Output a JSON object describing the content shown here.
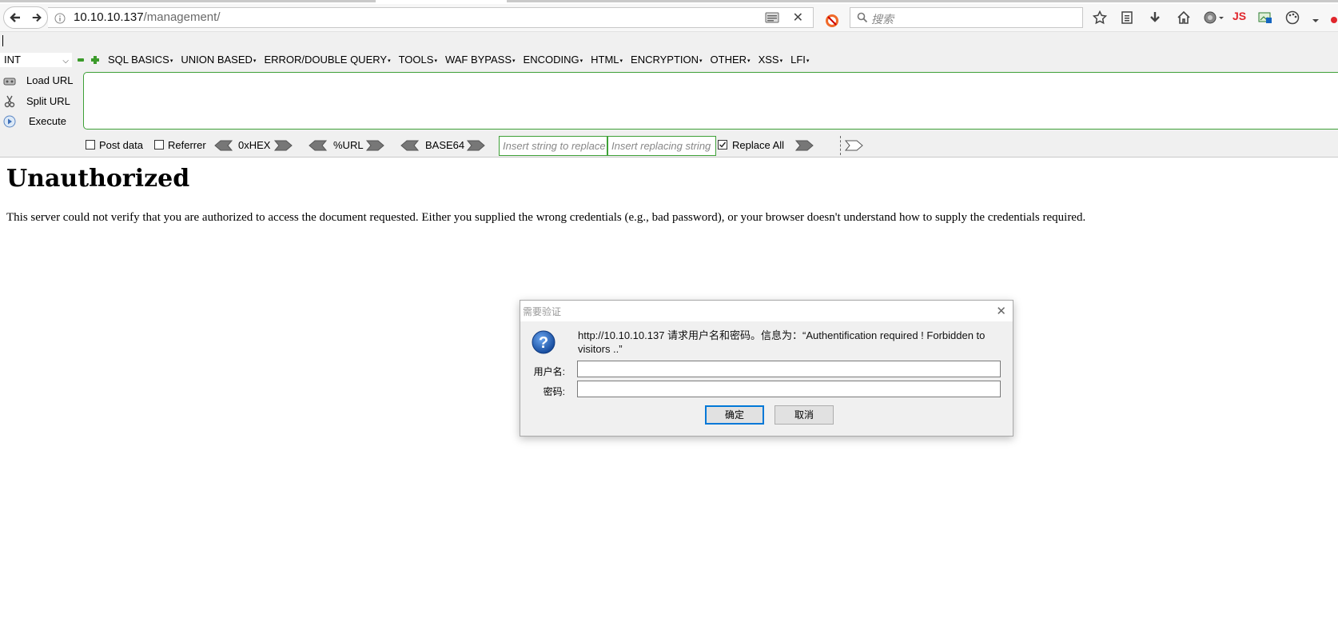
{
  "browser": {
    "url_host": "10.10.10.137",
    "url_path": "/management/",
    "search_placeholder": "搜索",
    "js_label": "JS"
  },
  "hackbar": {
    "int_select": "INT",
    "menus": [
      "SQL BASICS",
      "UNION BASED",
      "ERROR/DOUBLE QUERY",
      "TOOLS",
      "WAF BYPASS",
      "ENCODING",
      "HTML",
      "ENCRYPTION",
      "OTHER",
      "XSS",
      "LFI"
    ],
    "load_url": "Load URL",
    "split_url": "Split URL",
    "execute": "Execute",
    "post_data": "Post data",
    "referrer": "Referrer",
    "hex_label": "0xHEX",
    "url_label": "%URL",
    "base64_label": "BASE64",
    "replace_from_placeholder": "Insert string to replace",
    "replace_to_placeholder": "Insert replacing string",
    "replace_all": "Replace All",
    "replace_all_checked": true,
    "post_data_checked": false,
    "referrer_checked": false
  },
  "page": {
    "heading": "Unauthorized",
    "body": "This server could not verify that you are authorized to access the document requested. Either you supplied the wrong credentials (e.g., bad password), or your browser doesn't understand how to supply the credentials required."
  },
  "dialog": {
    "title": "需要验证",
    "message": "http://10.10.10.137 请求用户名和密码。信息为：“Authentification required ! Forbidden to visitors ..”",
    "username_label": "用户名:",
    "password_label": "密码:",
    "ok_label": "确定",
    "cancel_label": "取消"
  }
}
